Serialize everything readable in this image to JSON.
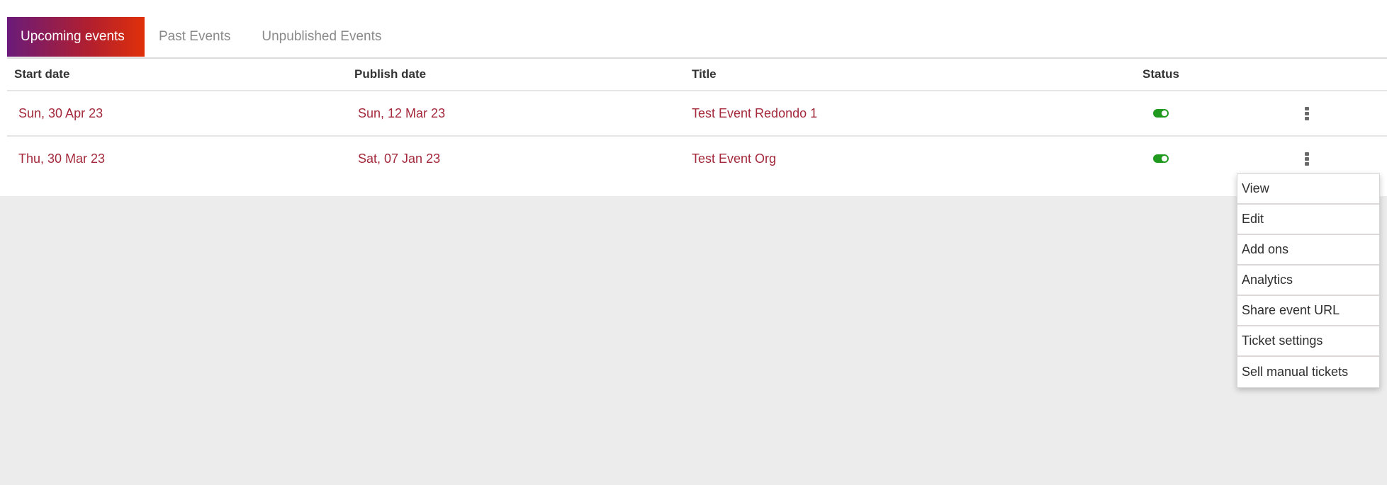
{
  "tabs": [
    {
      "label": "Upcoming events",
      "active": true
    },
    {
      "label": "Past Events",
      "active": false
    },
    {
      "label": "Unpublished Events",
      "active": false
    }
  ],
  "table": {
    "columns": {
      "start_date": "Start date",
      "publish_date": "Publish date",
      "title": "Title",
      "status": "Status"
    },
    "rows": [
      {
        "start_date": "Sun, 30 Apr 23",
        "publish_date": "Sun, 12 Mar 23",
        "title": "Test Event Redondo 1",
        "status": "on",
        "actions_icon": "kebab-menu-icon"
      },
      {
        "start_date": "Thu, 30 Mar 23",
        "publish_date": "Sat, 07 Jan 23",
        "title": "Test Event Org",
        "status": "on",
        "actions_icon": "kebab-menu-icon"
      }
    ]
  },
  "action_menu": {
    "open_for_row": 1,
    "items": [
      "View",
      "Edit",
      "Add ons",
      "Analytics",
      "Share event URL",
      "Ticket settings",
      "Sell manual tickets"
    ]
  },
  "colors": {
    "tab_gradient_start": "#6a1b7a",
    "tab_gradient_end": "#e0300a",
    "link_text": "#a3293b",
    "toggle_on": "#1f9a1f",
    "page_background": "#ececec"
  }
}
